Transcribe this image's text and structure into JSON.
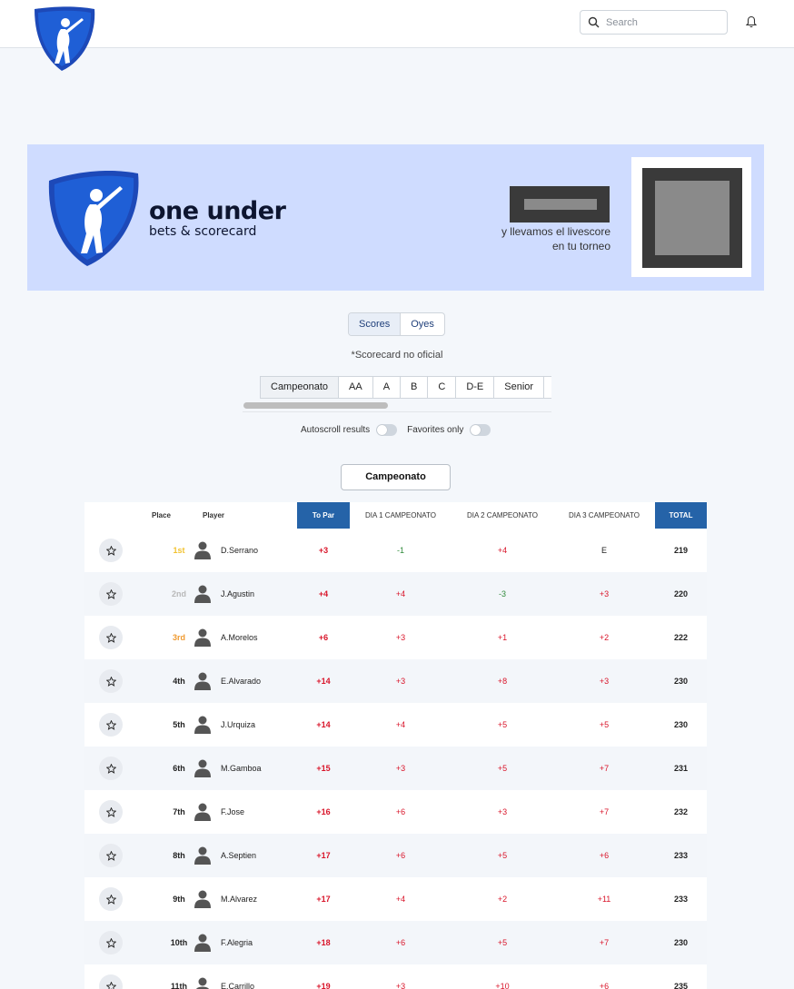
{
  "header": {
    "search_placeholder": "Search"
  },
  "banner": {
    "brand_name": "one under",
    "brand_tagline": "bets & scorecard",
    "promo_line1": "y llevamos el livescore",
    "promo_line2": "en tu torneo"
  },
  "view_tabs": [
    {
      "label": "Scores",
      "active": true
    },
    {
      "label": "Oyes",
      "active": false
    }
  ],
  "note": "*Scorecard no oficial",
  "categories": [
    {
      "label": "Campeonato",
      "active": true
    },
    {
      "label": "AA",
      "active": false
    },
    {
      "label": "A",
      "active": false
    },
    {
      "label": "B",
      "active": false
    },
    {
      "label": "C",
      "active": false
    },
    {
      "label": "D-E",
      "active": false
    },
    {
      "label": "Senior",
      "active": false
    }
  ],
  "toggles": {
    "autoscroll_label": "Autoscroll results",
    "favorites_label": "Favorites only"
  },
  "selected_category": "Campeonato",
  "table": {
    "headers": {
      "place": "Place",
      "player": "Player",
      "to_par": "To Par",
      "day1": "DIA 1 CAMPEONATO",
      "day2": "DIA 2 CAMPEONATO",
      "day3": "DIA 3 CAMPEONATO",
      "total": "TOTAL"
    },
    "rows": [
      {
        "place": "1st",
        "medal": "gold",
        "player": "D.Serrano",
        "to_par": "+3",
        "d1": "-1",
        "d2": "+4",
        "d3": "E",
        "total": "219"
      },
      {
        "place": "2nd",
        "medal": "silver",
        "player": "J.Agustin",
        "to_par": "+4",
        "d1": "+4",
        "d2": "-3",
        "d3": "+3",
        "total": "220"
      },
      {
        "place": "3rd",
        "medal": "bronze",
        "player": "A.Morelos",
        "to_par": "+6",
        "d1": "+3",
        "d2": "+1",
        "d3": "+2",
        "total": "222"
      },
      {
        "place": "4th",
        "medal": "",
        "player": "E.Alvarado",
        "to_par": "+14",
        "d1": "+3",
        "d2": "+8",
        "d3": "+3",
        "total": "230"
      },
      {
        "place": "5th",
        "medal": "",
        "player": "J.Urquiza",
        "to_par": "+14",
        "d1": "+4",
        "d2": "+5",
        "d3": "+5",
        "total": "230"
      },
      {
        "place": "6th",
        "medal": "",
        "player": "M.Gamboa",
        "to_par": "+15",
        "d1": "+3",
        "d2": "+5",
        "d3": "+7",
        "total": "231"
      },
      {
        "place": "7th",
        "medal": "",
        "player": "F.Jose",
        "to_par": "+16",
        "d1": "+6",
        "d2": "+3",
        "d3": "+7",
        "total": "232"
      },
      {
        "place": "8th",
        "medal": "",
        "player": "A.Septien",
        "to_par": "+17",
        "d1": "+6",
        "d2": "+5",
        "d3": "+6",
        "total": "233"
      },
      {
        "place": "9th",
        "medal": "",
        "player": "M.Alvarez",
        "to_par": "+17",
        "d1": "+4",
        "d2": "+2",
        "d3": "+11",
        "total": "233"
      },
      {
        "place": "10th",
        "medal": "",
        "player": "F.Alegria",
        "to_par": "+18",
        "d1": "+6",
        "d2": "+5",
        "d3": "+7",
        "total": "230"
      },
      {
        "place": "11th",
        "medal": "",
        "player": "E.Carrillo",
        "to_par": "+19",
        "d1": "+3",
        "d2": "+10",
        "d3": "+6",
        "total": "235"
      }
    ]
  },
  "colors": {
    "accent": "#2563a8",
    "banner_bg": "#cfdcff",
    "positive_score": "#d9152a",
    "negative_score": "#2f8a3a"
  },
  "icons": {
    "logo": "golfer-shield-logo",
    "search": "search-icon",
    "notifications": "bell-icon",
    "favorite": "star-icon",
    "player": "person-icon"
  }
}
